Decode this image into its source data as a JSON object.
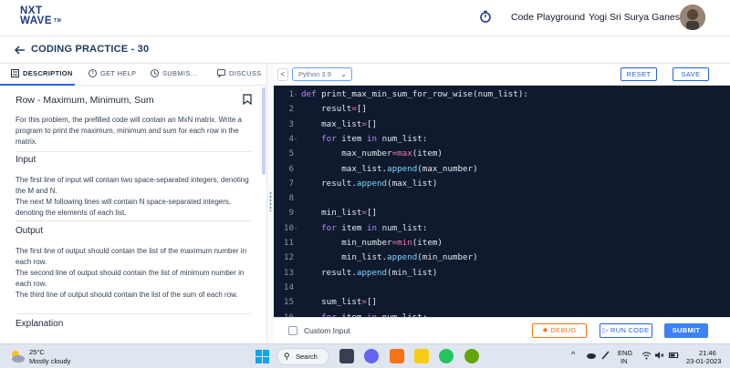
{
  "header": {
    "logo_line1": "NXT",
    "logo_line2": "WAVE",
    "logo_tm": "TM",
    "playground_link": "Code Playground",
    "user_name": "Yogi Sri Surya Ganesh"
  },
  "breadcrumb": {
    "title": "CODING PRACTICE - 30"
  },
  "left_tabs": [
    {
      "label": "DESCRIPTION",
      "icon": "list-icon"
    },
    {
      "label": "GET HELP",
      "icon": "help-circle-icon"
    },
    {
      "label": "SUBMIS...",
      "icon": "clock-icon"
    },
    {
      "label": "DISCUSS",
      "icon": "chat-icon"
    }
  ],
  "problem": {
    "title": "Row - Maximum, Minimum, Sum",
    "intro": "For this problem, the prefilled code will contain an MxN matrix. Write a program to print the maximum, minimum and sum for each row in the matrix.",
    "input_heading": "Input",
    "input_text1": "The first line of input will contain two space-separated integers, denoting the M and N.",
    "input_text2": "The next M following lines will contain N space-separated integers, denoting the elements of each list.",
    "output_heading": "Output",
    "output_text1": "The first line of output should contain the list of the maximum number in each row.",
    "output_text2": "The second line of output should contain the list of minimum number in each row.",
    "output_text3": "The third line of output should contain the list of the sum of each row.",
    "explanation_heading": "Explanation"
  },
  "toolbar": {
    "collapse": "<",
    "language": "Python 3.9",
    "reset": "RESET",
    "save": "SAVE"
  },
  "code_lines": [
    {
      "n": "1",
      "fold": "-",
      "text": "def print_max_min_sum_for_row_wise(num_list):"
    },
    {
      "n": "2",
      "fold": "",
      "text": "    result=[]"
    },
    {
      "n": "3",
      "fold": "",
      "text": "    max_list=[]"
    },
    {
      "n": "4",
      "fold": "-",
      "text": "    for item in num_list:"
    },
    {
      "n": "5",
      "fold": "",
      "text": "        max_number=max(item)"
    },
    {
      "n": "6",
      "fold": "",
      "text": "        max_list.append(max_number)"
    },
    {
      "n": "7",
      "fold": "",
      "text": "    result.append(max_list)"
    },
    {
      "n": "8",
      "fold": "",
      "text": ""
    },
    {
      "n": "9",
      "fold": "",
      "text": "    min_list=[]"
    },
    {
      "n": "10",
      "fold": "-",
      "text": "    for item in num_list:"
    },
    {
      "n": "11",
      "fold": "",
      "text": "        min_number=min(item)"
    },
    {
      "n": "12",
      "fold": "",
      "text": "        min_list.append(min_number)"
    },
    {
      "n": "13",
      "fold": "",
      "text": "    result.append(min_list)"
    },
    {
      "n": "14",
      "fold": "",
      "text": ""
    },
    {
      "n": "15",
      "fold": "",
      "text": "    sum_list=[]"
    },
    {
      "n": "16",
      "fold": "-",
      "text": "    for item in num_list:"
    }
  ],
  "bottom": {
    "custom_input": "Custom Input",
    "debug": "DEBUG",
    "run_code": "RUN CODE",
    "submit": "SUBMIT"
  },
  "taskbar": {
    "temperature": "25°C",
    "weather": "Mostly cloudy",
    "search": "Search",
    "lang_line1": "ENG",
    "lang_line2": "IN",
    "time": "21:46",
    "date": "23-01-2023"
  },
  "colors": {
    "brand": "#1e3a8a",
    "accent": "#2563eb",
    "editor_bg": "#0f1a2e",
    "debug": "#f97316",
    "submit": "#3b82f6"
  }
}
